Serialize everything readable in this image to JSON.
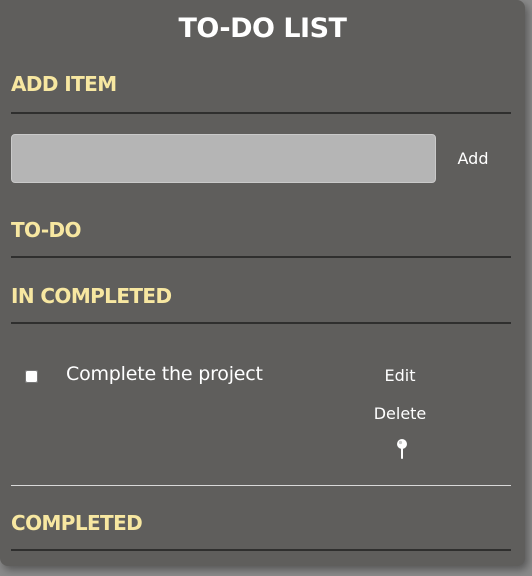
{
  "app": {
    "title": "TO-DO LIST"
  },
  "add_section": {
    "heading": "ADD ITEM",
    "input_value": "",
    "input_placeholder": "",
    "add_label": "Add"
  },
  "todo_section": {
    "heading": "TO-DO",
    "items": []
  },
  "incomplete_section": {
    "heading": "IN COMPLETED",
    "items": [
      {
        "label": "Complete the project",
        "checked": false,
        "edit_label": "Edit",
        "delete_label": "Delete",
        "icon": "pin-icon"
      }
    ]
  },
  "completed_section": {
    "heading": "COMPLETED",
    "items": []
  },
  "colors": {
    "panel_background": "#5f5e5c",
    "heading_accent": "#f7e7a1",
    "input_background": "#b5b5b5",
    "text": "#ffffff"
  }
}
